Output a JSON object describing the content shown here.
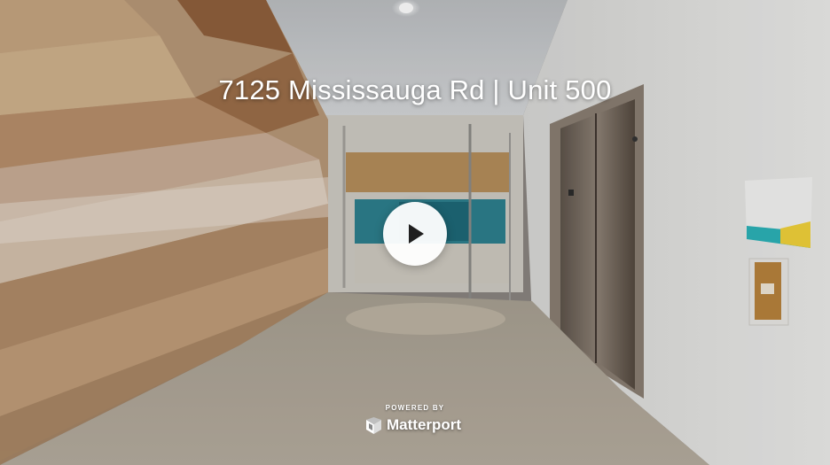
{
  "tour": {
    "title": "7125 Mississauga Rd | Unit 500",
    "play_icon": "play-icon",
    "powered_by": "POWERED BY",
    "brand_name": "Matterport",
    "brand_icon": "matterport-logo-icon"
  },
  "colors": {
    "overlay_text": "#ffffff",
    "play_button_bg": "#ffffff",
    "play_icon": "#1f1f1f"
  }
}
